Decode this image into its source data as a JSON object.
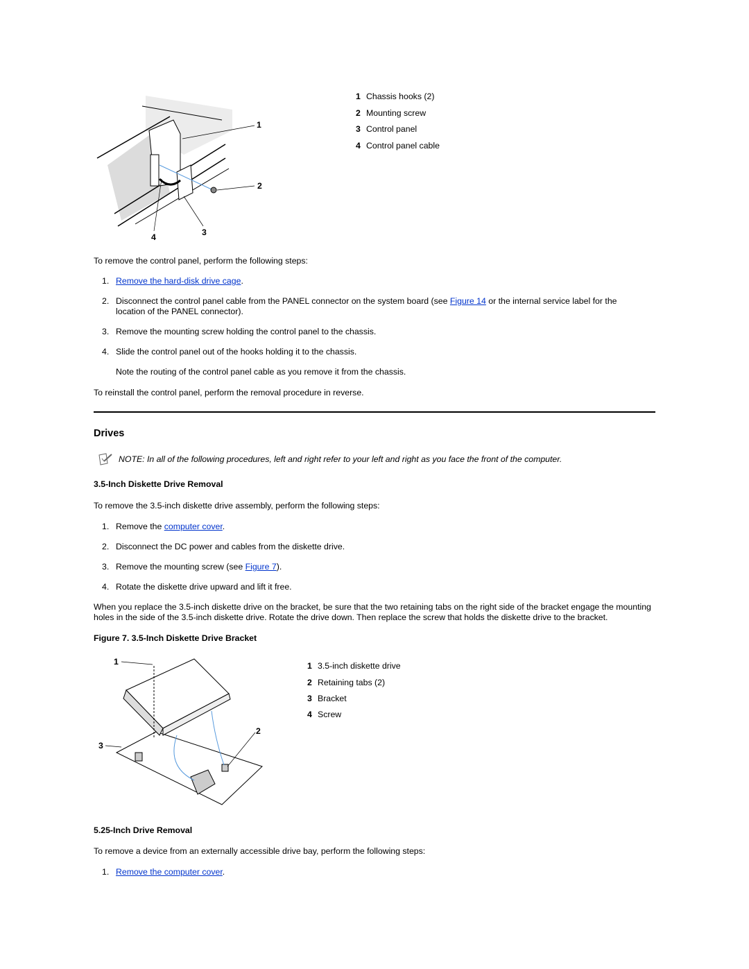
{
  "figure_control_panel": {
    "callouts": [
      "1",
      "2",
      "3",
      "4"
    ],
    "legend": [
      {
        "num": "1",
        "label": "Chassis hooks (2)"
      },
      {
        "num": "2",
        "label": "Mounting screw"
      },
      {
        "num": "3",
        "label": "Control panel"
      },
      {
        "num": "4",
        "label": "Control panel cable"
      }
    ]
  },
  "control_panel": {
    "intro": "To remove the control panel, perform the following steps:",
    "steps": [
      {
        "n": "1.",
        "link": "Remove the hard-disk drive cage",
        "after": "."
      },
      {
        "n": "2.",
        "before": "Disconnect the control panel cable from the PANEL connector on the system board (see ",
        "link": "Figure 14",
        "after": " or the internal service label for the location of the PANEL connector)."
      },
      {
        "n": "3.",
        "text": "Remove the mounting screw holding the control panel to the chassis."
      },
      {
        "n": "4.",
        "text": "Slide the control panel out of the hooks holding it to the chassis."
      }
    ],
    "step_note": "Note the routing of the control panel cable as you remove it from the chassis.",
    "reinstall": "To reinstall the control panel, perform the removal procedure in reverse."
  },
  "drives": {
    "title": "Drives",
    "note_icon": "note-pencil-icon",
    "note": "NOTE: In all of the following procedures, left and right refer to your left and right as you face the front of the computer.",
    "diskette": {
      "title": "3.5-Inch Diskette Drive Removal",
      "intro": "To remove the 3.5-inch diskette drive assembly, perform the following steps:",
      "steps": [
        {
          "n": "1.",
          "before": "Remove the ",
          "link": "computer cover",
          "after": "."
        },
        {
          "n": "2.",
          "text": "Disconnect the DC power and cables from the diskette drive."
        },
        {
          "n": "3.",
          "before": "Remove the mounting screw (see ",
          "link": "Figure 7",
          "after": ")."
        },
        {
          "n": "4.",
          "text": "Rotate the diskette drive upward and lift it free."
        }
      ],
      "replace": "When you replace the 3.5-inch diskette drive on the bracket, be sure that the two retaining tabs on the right side of the bracket engage the mounting holes in the side of the 3.5-inch diskette drive. Rotate the drive down. Then replace the screw that holds the diskette drive to the bracket.",
      "figure_caption": "Figure 7. 3.5-Inch Diskette Drive Bracket",
      "callouts": [
        "1",
        "2",
        "3"
      ],
      "legend": [
        {
          "num": "1",
          "label": "3.5-inch diskette drive"
        },
        {
          "num": "2",
          "label": "Retaining tabs (2)"
        },
        {
          "num": "3",
          "label": "Bracket"
        },
        {
          "num": "4",
          "label": "Screw"
        }
      ]
    },
    "drive525": {
      "title": "5.25-Inch Drive Removal",
      "intro": "To remove a device from an externally accessible drive bay, perform the following steps:",
      "steps": [
        {
          "n": "1.",
          "link": "Remove the computer cover",
          "after": "."
        }
      ]
    }
  },
  "colors": {
    "link": "#0033cc",
    "text": "#000000"
  }
}
